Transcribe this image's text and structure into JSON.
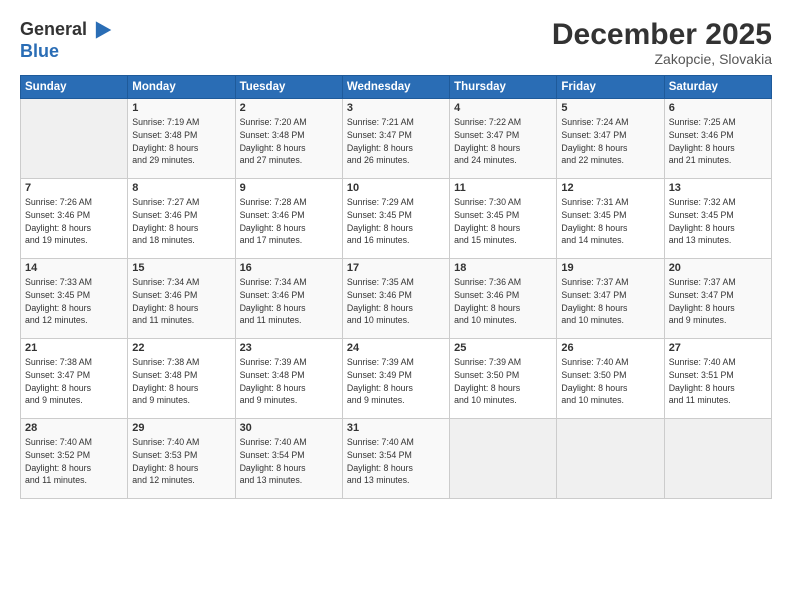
{
  "logo": {
    "line1": "General",
    "line2": "Blue"
  },
  "title": "December 2025",
  "location": "Zakopcie, Slovakia",
  "days_header": [
    "Sunday",
    "Monday",
    "Tuesday",
    "Wednesday",
    "Thursday",
    "Friday",
    "Saturday"
  ],
  "weeks": [
    [
      {
        "num": "",
        "info": ""
      },
      {
        "num": "1",
        "info": "Sunrise: 7:19 AM\nSunset: 3:48 PM\nDaylight: 8 hours\nand 29 minutes."
      },
      {
        "num": "2",
        "info": "Sunrise: 7:20 AM\nSunset: 3:48 PM\nDaylight: 8 hours\nand 27 minutes."
      },
      {
        "num": "3",
        "info": "Sunrise: 7:21 AM\nSunset: 3:47 PM\nDaylight: 8 hours\nand 26 minutes."
      },
      {
        "num": "4",
        "info": "Sunrise: 7:22 AM\nSunset: 3:47 PM\nDaylight: 8 hours\nand 24 minutes."
      },
      {
        "num": "5",
        "info": "Sunrise: 7:24 AM\nSunset: 3:47 PM\nDaylight: 8 hours\nand 22 minutes."
      },
      {
        "num": "6",
        "info": "Sunrise: 7:25 AM\nSunset: 3:46 PM\nDaylight: 8 hours\nand 21 minutes."
      }
    ],
    [
      {
        "num": "7",
        "info": "Sunrise: 7:26 AM\nSunset: 3:46 PM\nDaylight: 8 hours\nand 19 minutes."
      },
      {
        "num": "8",
        "info": "Sunrise: 7:27 AM\nSunset: 3:46 PM\nDaylight: 8 hours\nand 18 minutes."
      },
      {
        "num": "9",
        "info": "Sunrise: 7:28 AM\nSunset: 3:46 PM\nDaylight: 8 hours\nand 17 minutes."
      },
      {
        "num": "10",
        "info": "Sunrise: 7:29 AM\nSunset: 3:45 PM\nDaylight: 8 hours\nand 16 minutes."
      },
      {
        "num": "11",
        "info": "Sunrise: 7:30 AM\nSunset: 3:45 PM\nDaylight: 8 hours\nand 15 minutes."
      },
      {
        "num": "12",
        "info": "Sunrise: 7:31 AM\nSunset: 3:45 PM\nDaylight: 8 hours\nand 14 minutes."
      },
      {
        "num": "13",
        "info": "Sunrise: 7:32 AM\nSunset: 3:45 PM\nDaylight: 8 hours\nand 13 minutes."
      }
    ],
    [
      {
        "num": "14",
        "info": "Sunrise: 7:33 AM\nSunset: 3:45 PM\nDaylight: 8 hours\nand 12 minutes."
      },
      {
        "num": "15",
        "info": "Sunrise: 7:34 AM\nSunset: 3:46 PM\nDaylight: 8 hours\nand 11 minutes."
      },
      {
        "num": "16",
        "info": "Sunrise: 7:34 AM\nSunset: 3:46 PM\nDaylight: 8 hours\nand 11 minutes."
      },
      {
        "num": "17",
        "info": "Sunrise: 7:35 AM\nSunset: 3:46 PM\nDaylight: 8 hours\nand 10 minutes."
      },
      {
        "num": "18",
        "info": "Sunrise: 7:36 AM\nSunset: 3:46 PM\nDaylight: 8 hours\nand 10 minutes."
      },
      {
        "num": "19",
        "info": "Sunrise: 7:37 AM\nSunset: 3:47 PM\nDaylight: 8 hours\nand 10 minutes."
      },
      {
        "num": "20",
        "info": "Sunrise: 7:37 AM\nSunset: 3:47 PM\nDaylight: 8 hours\nand 9 minutes."
      }
    ],
    [
      {
        "num": "21",
        "info": "Sunrise: 7:38 AM\nSunset: 3:47 PM\nDaylight: 8 hours\nand 9 minutes."
      },
      {
        "num": "22",
        "info": "Sunrise: 7:38 AM\nSunset: 3:48 PM\nDaylight: 8 hours\nand 9 minutes."
      },
      {
        "num": "23",
        "info": "Sunrise: 7:39 AM\nSunset: 3:48 PM\nDaylight: 8 hours\nand 9 minutes."
      },
      {
        "num": "24",
        "info": "Sunrise: 7:39 AM\nSunset: 3:49 PM\nDaylight: 8 hours\nand 9 minutes."
      },
      {
        "num": "25",
        "info": "Sunrise: 7:39 AM\nSunset: 3:50 PM\nDaylight: 8 hours\nand 10 minutes."
      },
      {
        "num": "26",
        "info": "Sunrise: 7:40 AM\nSunset: 3:50 PM\nDaylight: 8 hours\nand 10 minutes."
      },
      {
        "num": "27",
        "info": "Sunrise: 7:40 AM\nSunset: 3:51 PM\nDaylight: 8 hours\nand 11 minutes."
      }
    ],
    [
      {
        "num": "28",
        "info": "Sunrise: 7:40 AM\nSunset: 3:52 PM\nDaylight: 8 hours\nand 11 minutes."
      },
      {
        "num": "29",
        "info": "Sunrise: 7:40 AM\nSunset: 3:53 PM\nDaylight: 8 hours\nand 12 minutes."
      },
      {
        "num": "30",
        "info": "Sunrise: 7:40 AM\nSunset: 3:54 PM\nDaylight: 8 hours\nand 13 minutes."
      },
      {
        "num": "31",
        "info": "Sunrise: 7:40 AM\nSunset: 3:54 PM\nDaylight: 8 hours\nand 13 minutes."
      },
      {
        "num": "",
        "info": ""
      },
      {
        "num": "",
        "info": ""
      },
      {
        "num": "",
        "info": ""
      }
    ]
  ]
}
